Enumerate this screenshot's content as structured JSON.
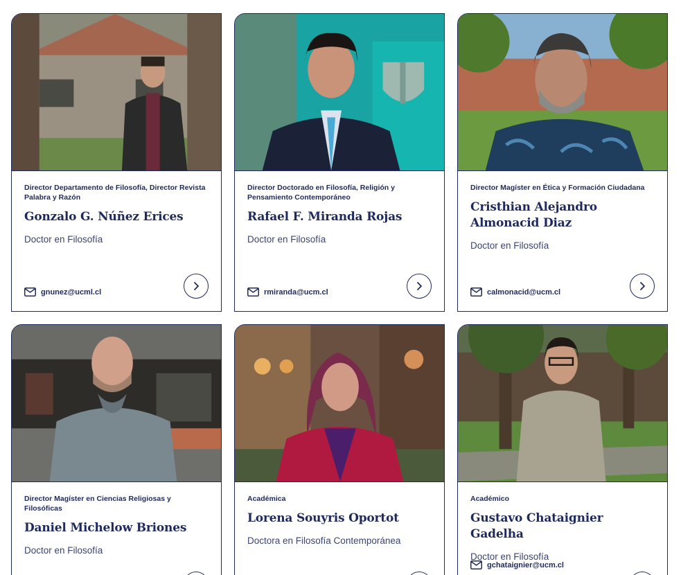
{
  "people": [
    {
      "role": "Director Departamento de Filosofía, Director Revista Palabra y Razón",
      "name": "Gonzalo G. Núñez Erices",
      "degree": "Doctor en Filosofía",
      "email": "gnunez@ucml.cl",
      "photo_icon": "portrait-photo"
    },
    {
      "role": "Director Doctorado en Filosofía, Religión y Pensamiento Contemporáneo",
      "name": "Rafael F. Miranda Rojas",
      "degree": "Doctor en Filosofía",
      "email": "rmiranda@ucm.cl",
      "photo_icon": "portrait-photo"
    },
    {
      "role": "Director Magíster en Ética y Formación Ciudadana",
      "name": "Cristhian Alejandro Almonacid Diaz",
      "degree": "Doctor en Filosofía",
      "email": "calmonacid@ucm.cl",
      "photo_icon": "portrait-photo"
    },
    {
      "role": "Director Magíster en Ciencias Religiosas y Filosóficas",
      "name": "Daniel Michelow Briones",
      "degree": "Doctor en Filosofía",
      "email": "",
      "photo_icon": "portrait-photo"
    },
    {
      "role": "Académica",
      "name": "Lorena Souyris Oportot",
      "degree": "Doctora en Filosofía Contemporánea",
      "email": "",
      "photo_icon": "portrait-photo"
    },
    {
      "role": "Académico",
      "name": "Gustavo Chataignier Gadelha",
      "degree": "Doctor en Filosofía",
      "email": "gchataignier@ucm.cl",
      "photo_icon": "portrait-photo"
    }
  ],
  "icons": {
    "email": "mail-icon",
    "more": "chevron-right-icon"
  },
  "colors": {
    "primary": "#1f2a5c",
    "text_muted": "#3b4470",
    "background": "#ffffff"
  }
}
